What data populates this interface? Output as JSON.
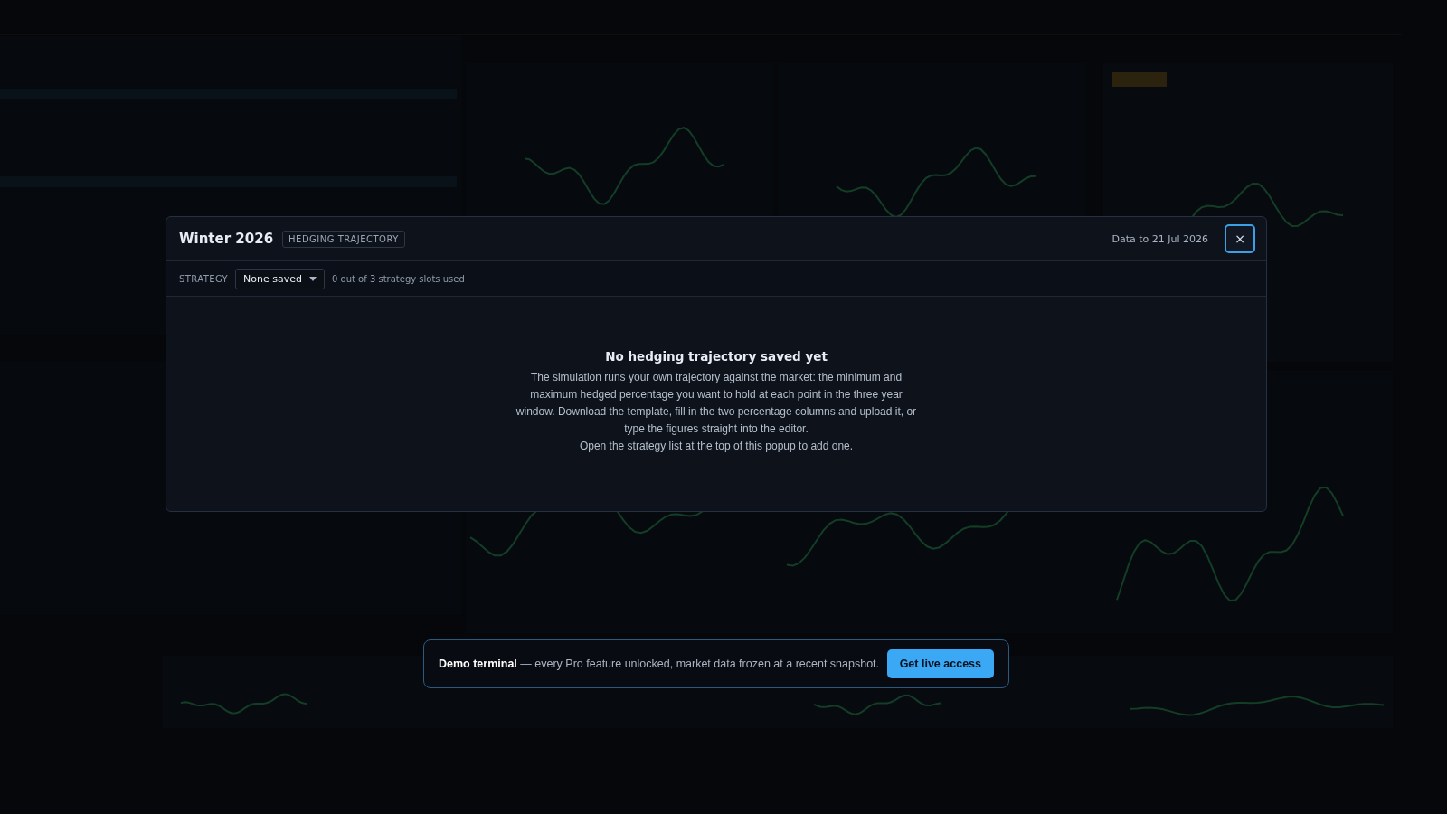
{
  "modal": {
    "title": "Winter 2026",
    "badge": "HEDGING TRAJECTORY",
    "data_date": "Data to 21 Jul 2026",
    "close": "×",
    "strategy_label": "STRATEGY",
    "strategy_select": "None saved",
    "slots": "0 out of 3 strategy slots used",
    "empty_title": "No hedging trajectory saved yet",
    "empty_paragraphs": [
      "The simulation runs your own trajectory against the market: the minimum and maximum hedged percentage you want to hold at each point in the three year window. Download the template, fill in the two percentage columns and upload it, or type the figures straight into the editor.",
      "Open the strategy list at the top of this popup to add one."
    ]
  },
  "banner": {
    "text": "**Demo terminal** — every Pro feature unlocked, market data frozen at a recent snapshot.",
    "button": "Get live access"
  }
}
